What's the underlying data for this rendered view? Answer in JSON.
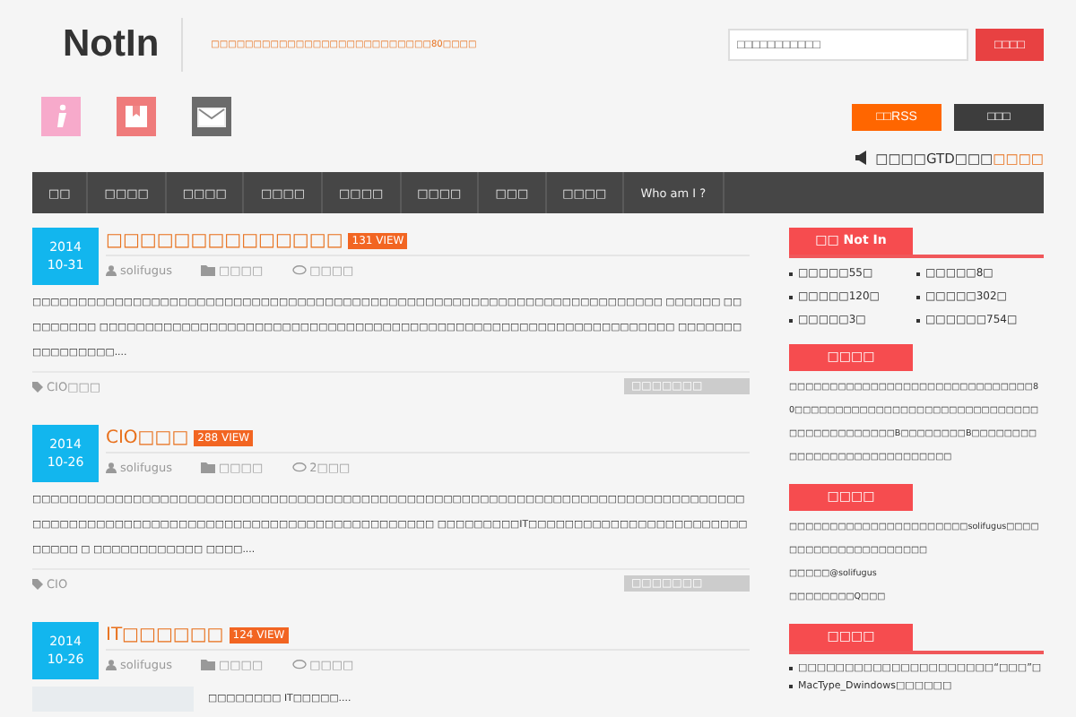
{
  "header": {
    "logo": "NotIn",
    "tagline": "□□□□□□□□□□□□□□□□□□□□□□□□□□80□□□□",
    "search": {
      "placeholder": "□□□□□□□□□□□"
    },
    "search_button": "□□□□"
  },
  "actions": {
    "rss_button": "□□RSS",
    "dark_button": "□□□"
  },
  "notice": {
    "text": "□□□□GTD□□□",
    "link": "□□□□"
  },
  "nav": [
    "□□",
    "□□□□",
    "□□□□",
    "□□□□",
    "□□□□",
    "□□□□",
    "□□□",
    "□□□□",
    "Who am I ?"
  ],
  "posts": [
    {
      "year": "2014",
      "date": "10-31",
      "title": "□□□□□□□□□□□□□□",
      "views": "131 VIEW",
      "author": "solifugus",
      "category": "□□□□",
      "comments": "□□□□",
      "excerpt": "□□□□□□□□□□□□□□□□□□□□□□□□□□□□□□□□□□□□□□□□□□□□□□□□□□□□□□□□□□□□□□□□□□□□□ □□□□□□ □□□□□□□□□ □□□□□□□□□□□□□□□□□□□□□□□□□□□□□□□□□□□□□□□□□□□□□□□□□□□□□□□□□□□□□□□ □□□□□□□□□□□□□□□□....",
      "tags": "CIO□□□",
      "more": "□□□□□□□",
      "thumbnail": false
    },
    {
      "year": "2014",
      "date": "10-26",
      "title": "CIO□□□",
      "views": "288 VIEW",
      "author": "solifugus",
      "category": "□□□□",
      "comments": "2□□□",
      "excerpt": "□□□□□□□□□□□□□□□□□□□□□□□□□□□□□□□□□□□□□□□□□□□□□□□□□□□□□□□□□□□□□□□□□□□□□□□□□□□□□□□□□□□□□□□□□□□□□□□□□□□□□□□□□□□□□□□□□□□□□□□□□□ □□□□□□□□□IT□□□□□□□□□□□□□□□□□□□□□□□□□□□□□ □ □□□□□□□□□□□□ □□□□....",
      "tags": "CIO",
      "more": "□□□□□□□",
      "thumbnail": false
    },
    {
      "year": "2014",
      "date": "10-26",
      "title": "IT□□□□□□",
      "views": "124 VIEW",
      "author": "solifugus",
      "category": "□□□□",
      "comments": "□□□□",
      "excerpt": "□□□□□□□□ IT□□□□□....",
      "thumbnail": true
    }
  ],
  "sidebar": {
    "stats_title": "□□ Not In",
    "stats": [
      "□□□□□55□",
      "□□□□□8□",
      "□□□□□120□",
      "□□□□□302□",
      "□□□□□3□",
      "□□□□□□754□"
    ],
    "about_title": "□□□□",
    "about_text": "□□□□□□□□□□□□□□□□□□□□□□□□□□□□□□80□□□□□□□□□□□□□□□□□□□□□□□□□□□□□□□□□□□□□□□□□□□B□□□□□□□□B□□□□□□□□□□□□□□□□□□□□□□□□□□□□",
    "contact_title": "□□□□",
    "contact_lines": [
      "□□□□□□□□□□□□□□□□□□□□□□solifugus□□□□□□□□□□□□□□□□□□□□□",
      "□□□□□@solifugus",
      "□□□□□□□□Q□□□"
    ],
    "recent_title": "□□□□",
    "recent": [
      "□□□□□□□□□□□□□□□□□□□□□“□□□”□",
      "MacType_Dwindows□□□□□□"
    ]
  }
}
